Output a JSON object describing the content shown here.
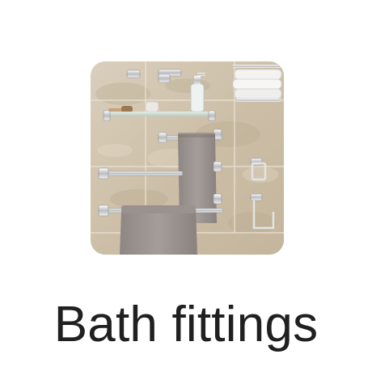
{
  "category": {
    "label": "Bath fittings",
    "image_subject": "bath-fittings-photo"
  }
}
